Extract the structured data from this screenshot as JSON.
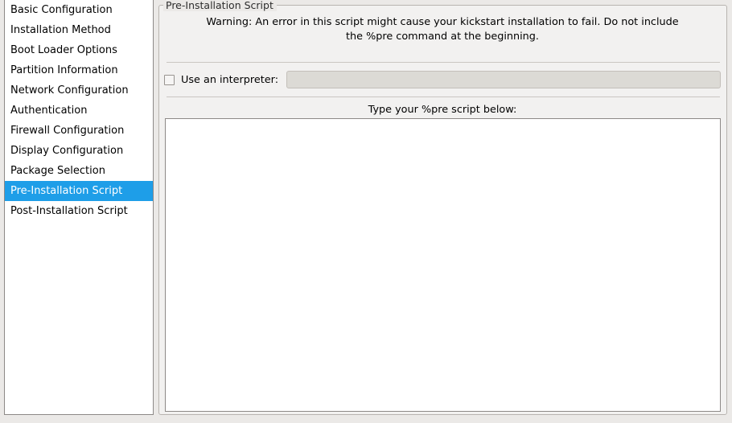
{
  "sidebar": {
    "items": [
      {
        "label": "Basic Configuration",
        "selected": false
      },
      {
        "label": "Installation Method",
        "selected": false
      },
      {
        "label": "Boot Loader Options",
        "selected": false
      },
      {
        "label": "Partition Information",
        "selected": false
      },
      {
        "label": "Network Configuration",
        "selected": false
      },
      {
        "label": "Authentication",
        "selected": false
      },
      {
        "label": "Firewall Configuration",
        "selected": false
      },
      {
        "label": "Display Configuration",
        "selected": false
      },
      {
        "label": "Package Selection",
        "selected": false
      },
      {
        "label": "Pre-Installation Script",
        "selected": true
      },
      {
        "label": "Post-Installation Script",
        "selected": false
      }
    ]
  },
  "panel": {
    "frame_legend": "Pre-Installation Script",
    "warning_text": "Warning: An error in this script might cause your kickstart installation to fail. Do not include the %pre command at the beginning.",
    "interpreter": {
      "checkbox_label": "Use an interpreter:",
      "checked": false,
      "input_value": "",
      "input_placeholder": "",
      "input_enabled": false
    },
    "script_label": "Type your %pre script below:",
    "script_value": "",
    "script_placeholder": ""
  },
  "colors": {
    "selection_blue": "#1e9ee8",
    "window_background": "#ebe9e7",
    "panel_background": "#f2f1f0",
    "field_disabled": "#dcdad5",
    "border_gray": "#8d8987"
  }
}
